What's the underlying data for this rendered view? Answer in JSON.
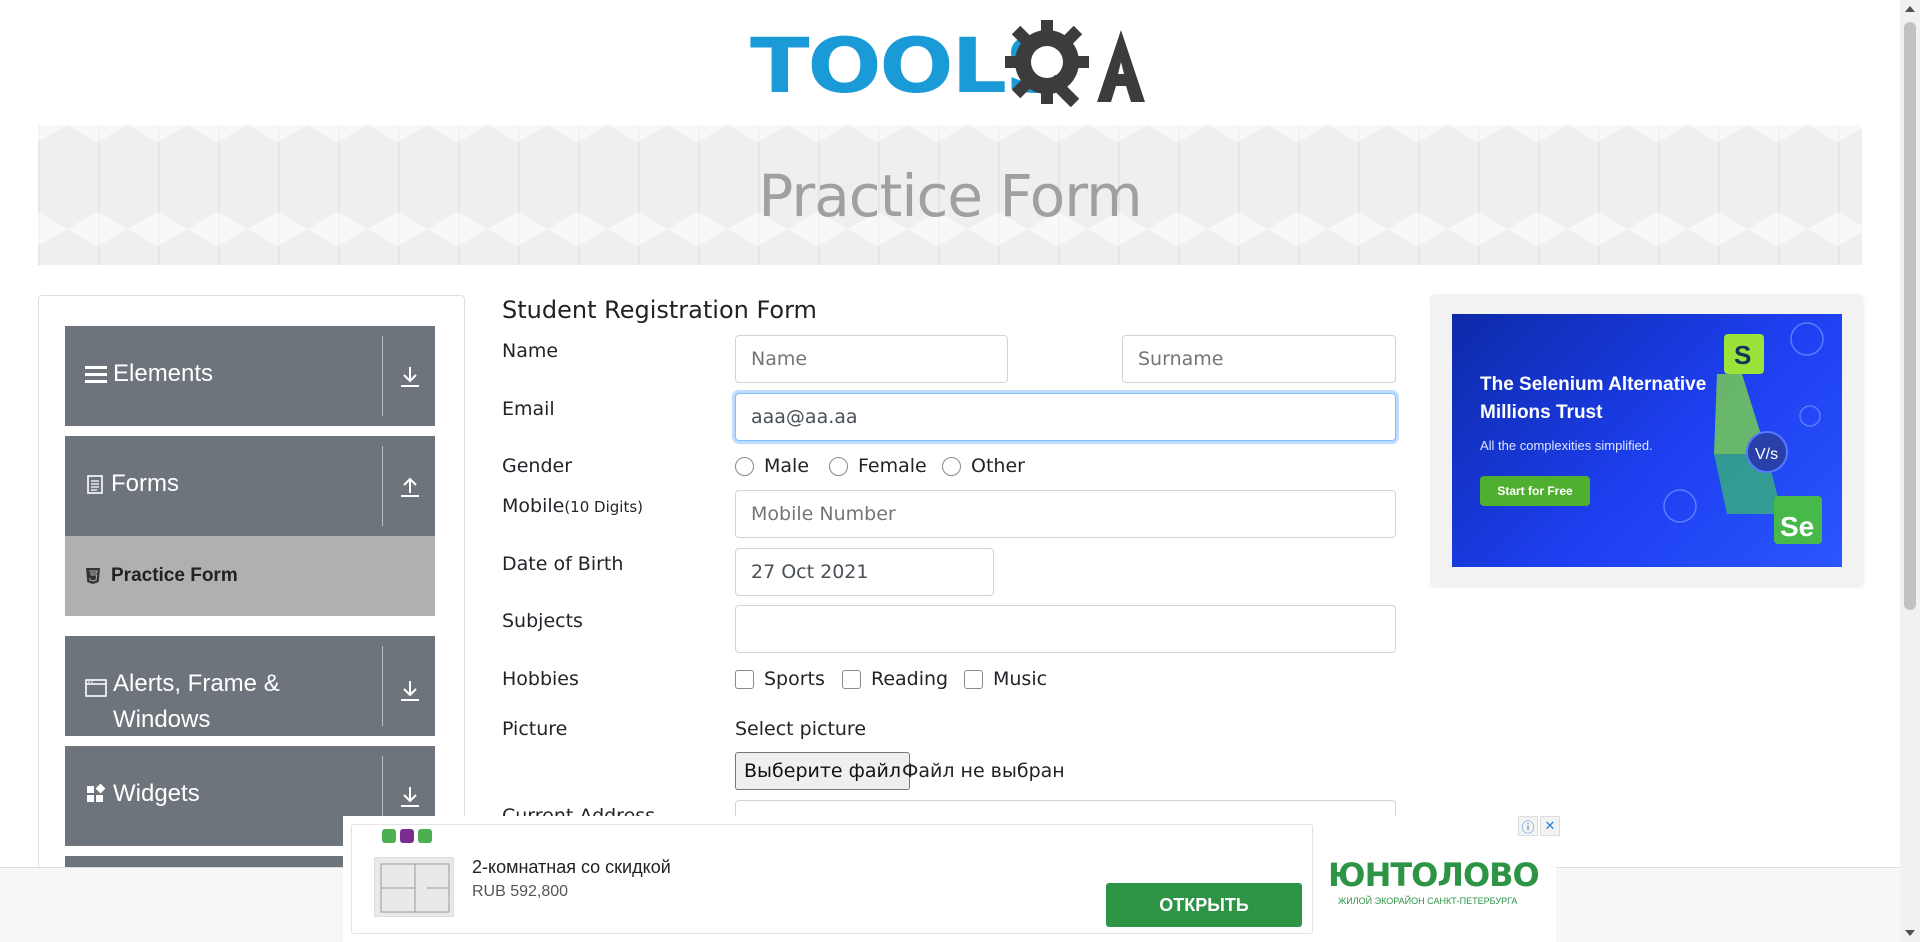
{
  "header": {
    "logo_text": "TOOLSQA"
  },
  "banner": {
    "title": "Practice Form"
  },
  "sidebar": {
    "groups": [
      {
        "label": "Elements",
        "icon": "hamburger-icon",
        "expanded": false
      },
      {
        "label": "Forms",
        "icon": "document-icon",
        "expanded": true
      },
      {
        "label": "Alerts, Frame & Windows",
        "icon": "window-icon",
        "expanded": false
      },
      {
        "label": "Widgets",
        "icon": "widgets-icon",
        "expanded": false
      }
    ],
    "active_item": {
      "label": "Practice Form",
      "icon": "html5-icon"
    }
  },
  "form": {
    "title": "Student Registration Form",
    "name_label": "Name",
    "first_name_placeholder": "Name",
    "last_name_placeholder": "Surname",
    "email_label": "Email",
    "email_value": "aaa@aa.aa",
    "gender_label": "Gender",
    "gender_options": [
      "Male",
      "Female",
      "Other"
    ],
    "mobile_label": "Mobile",
    "mobile_hint": "(10 Digits)",
    "mobile_placeholder": "Mobile Number",
    "dob_label": "Date of Birth",
    "dob_value": "27 Oct 2021",
    "subjects_label": "Subjects",
    "hobbies_label": "Hobbies",
    "hobbies_options": [
      "Sports",
      "Reading",
      "Music"
    ],
    "picture_label": "Picture",
    "picture_hint": "Select picture",
    "file_button": "Выберите файл",
    "file_status": "Файл не выбран",
    "address_label": "Current Address"
  },
  "ad_right": {
    "headline": "The Selenium Alternative Millions Trust",
    "sub": "All the complexities simplified.",
    "cta": "Start for Free"
  },
  "ad_bottom": {
    "title": "2-комнатная со скидкой",
    "price": "RUB 592,800",
    "button": "ОТКРЫТЬ",
    "brand": "ЮНТОЛОВО",
    "brand_sub": "ЖИЛОЙ ЭКОРАЙОН САНКТ-ПЕТЕРБУРГА"
  },
  "colors": {
    "brand_blue": "#1a9bd7",
    "sidebar_bg": "#6e747b",
    "active_item_bg": "#b0b0b0",
    "ad_green": "#2e9445"
  }
}
